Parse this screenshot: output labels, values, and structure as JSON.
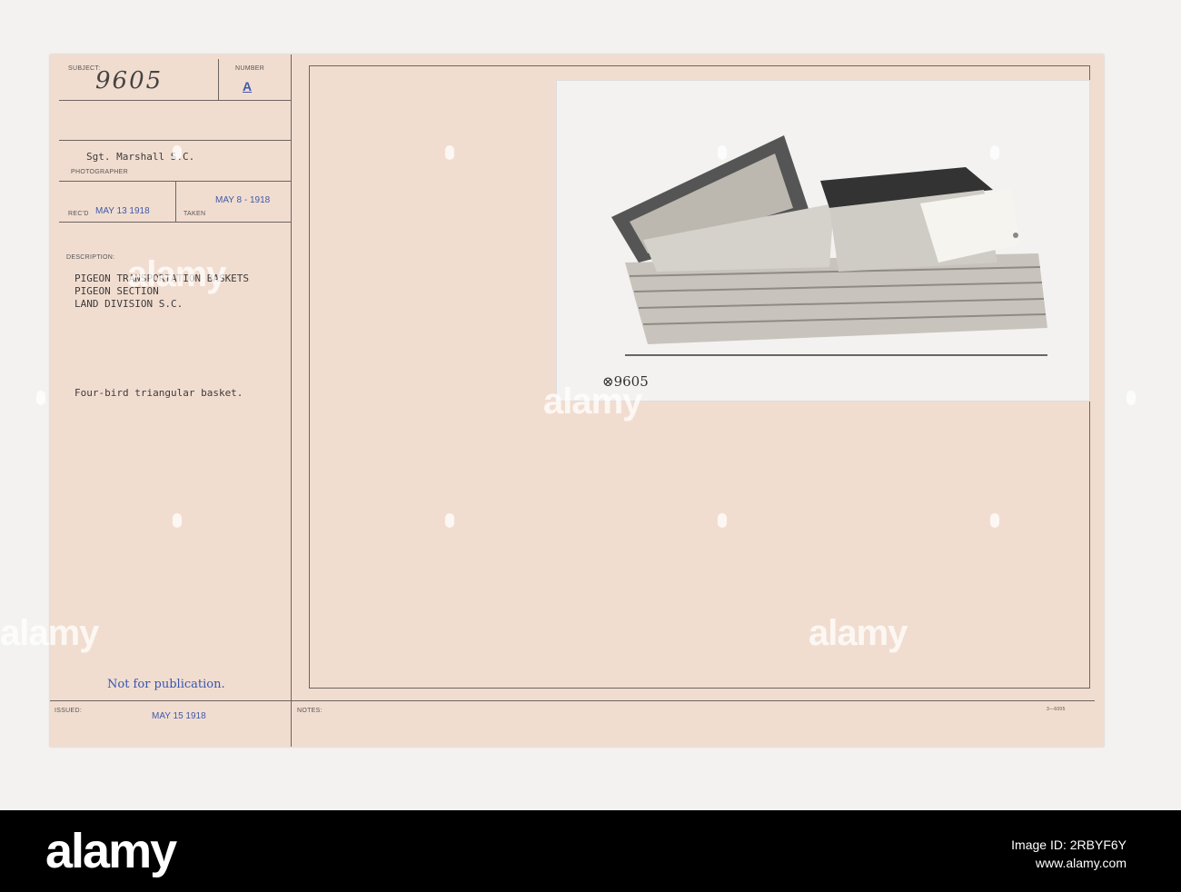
{
  "card": {
    "subject_label": "SUBJECT:",
    "subject_value": "9605",
    "number_label": "NUMBER",
    "number_value": "A",
    "photographer_value": "Sgt. Marshall S.C.",
    "photographer_label": "PHOTOGRAPHER",
    "recd_label": "REC'D",
    "recd_value": "MAY 13 1918",
    "taken_label": "TAKEN",
    "taken_value": "MAY 8 - 1918",
    "description_label": "DESCRIPTION:",
    "description_lines": [
      "PIGEON TRANSPORTATION BASKETS",
      "PIGEON SECTION",
      "LAND DIVISION S.C."
    ],
    "caption": "Four-bird triangular basket.",
    "publication_stamp": "Not for publication.",
    "issued_label": "ISSUED:",
    "issued_value": "MAY 15 1918",
    "notes_label": "NOTES:",
    "form_number": "3—6005",
    "photo_number": "⊗9605"
  },
  "watermark": {
    "text": "alamy"
  },
  "footer": {
    "logo": "alamy",
    "image_id_label": "Image ID:",
    "image_id": "2RBYF6Y",
    "url": "www.alamy.com"
  }
}
